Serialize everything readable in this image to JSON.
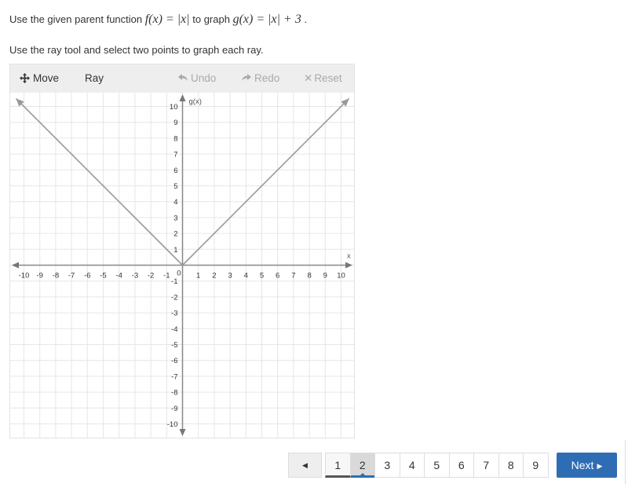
{
  "prompt": {
    "prefix": "Use the given parent function ",
    "parent_function": "f(x) = |x|",
    "middle": " to graph ",
    "target_function": "g(x) = |x| + 3",
    "suffix": " ."
  },
  "instruction": "Use the ray tool and select two points to graph each ray.",
  "toolbar": {
    "move_label": "Move",
    "ray_label": "Ray",
    "undo_label": "Undo",
    "redo_label": "Redo",
    "reset_label": "Reset",
    "move_icon": "move-arrows-icon",
    "undo_icon": "undo-arrow-icon",
    "redo_icon": "redo-arrow-icon",
    "reset_icon": "close-x-icon"
  },
  "graph": {
    "x_axis_label": "x",
    "y_axis_label": "g(x)",
    "x_range": [
      -10,
      10
    ],
    "y_range": [
      -10,
      10
    ],
    "origin_label": "0",
    "x_tick_labels": [
      "-10",
      "-9",
      "-8",
      "-7",
      "-6",
      "-5",
      "-4",
      "-3",
      "-2",
      "-1",
      "1",
      "2",
      "3",
      "4",
      "5",
      "6",
      "7",
      "8",
      "9",
      "10"
    ],
    "y_tick_labels": [
      "10",
      "9",
      "8",
      "7",
      "6",
      "5",
      "4",
      "3",
      "2",
      "1",
      "-1",
      "-2",
      "-3",
      "-4",
      "-5",
      "-6",
      "-7",
      "-8",
      "-9",
      "-10"
    ],
    "rays": [
      {
        "from": [
          0,
          0
        ],
        "through": [
          -10.5,
          10.5
        ]
      },
      {
        "from": [
          0,
          0
        ],
        "through": [
          10.5,
          10.5
        ]
      }
    ],
    "line_color": "#999999"
  },
  "pagination": {
    "prev_label": "◀",
    "pages": [
      "1",
      "2",
      "3",
      "4",
      "5",
      "6",
      "7",
      "8",
      "9"
    ],
    "current_page": "2",
    "completed_pages": [
      "1"
    ],
    "next_label": "Next",
    "next_icon": "▶"
  }
}
